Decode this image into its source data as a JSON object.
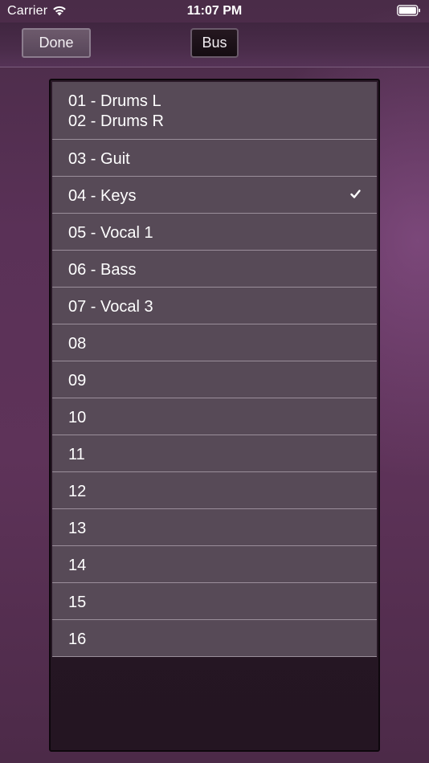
{
  "status_bar": {
    "carrier": "Carrier",
    "time": "11:07 PM",
    "wifi_icon": "wifi-icon",
    "battery_icon": "battery-icon"
  },
  "toolbar": {
    "done_label": "Done",
    "bus_label": "Bus"
  },
  "bus_list": {
    "selected_index": 2,
    "items": [
      {
        "label": "01 - Drums L\n02 - Drums R",
        "checked": false
      },
      {
        "label": "03 - Guit",
        "checked": false
      },
      {
        "label": "04 - Keys",
        "checked": true
      },
      {
        "label": "05 - Vocal 1",
        "checked": false
      },
      {
        "label": "06 - Bass",
        "checked": false
      },
      {
        "label": "07 - Vocal 3",
        "checked": false
      },
      {
        "label": "08",
        "checked": false
      },
      {
        "label": "09",
        "checked": false
      },
      {
        "label": "10",
        "checked": false
      },
      {
        "label": "11",
        "checked": false
      },
      {
        "label": "12",
        "checked": false
      },
      {
        "label": "13",
        "checked": false
      },
      {
        "label": "14",
        "checked": false
      },
      {
        "label": "15",
        "checked": false
      },
      {
        "label": "16",
        "checked": false
      }
    ]
  },
  "colors": {
    "background": "#5a3157",
    "row": "#574a57",
    "separator": "#9a8e9a",
    "panel_empty": "#2a1928"
  }
}
